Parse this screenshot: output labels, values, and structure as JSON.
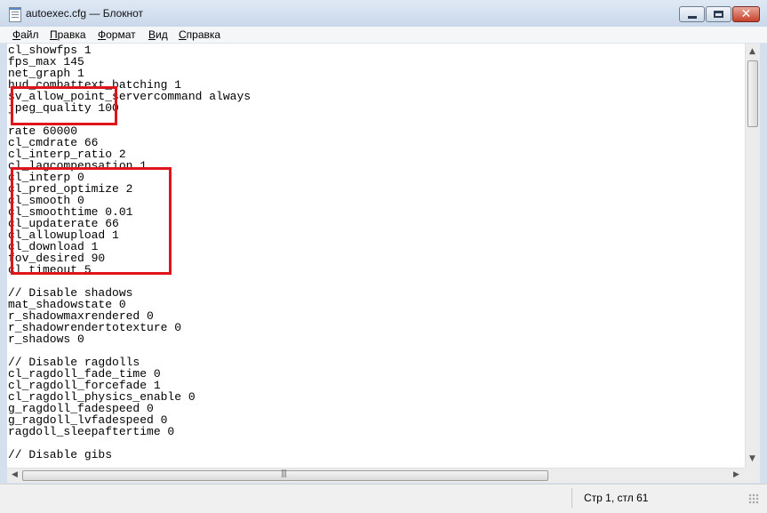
{
  "window": {
    "title": "autoexec.cfg — Блокнот",
    "icon": "notepad-icon"
  },
  "titlebar_buttons": {
    "minimize": "minimize-icon",
    "maximize": "maximize-icon",
    "close": "close-icon",
    "close_glyph": "✕"
  },
  "menu": {
    "file": "Файл",
    "edit": "Правка",
    "format": "Формат",
    "view": "Вид",
    "help": "Справка"
  },
  "editor": {
    "content": "cl_showfps 1\nfps_max 145\nnet_graph 1\nhud_combattext_batching 1\nsv_allow_point_servercommand always\njpeg_quality 100\n\nrate 60000\ncl_cmdrate 66\ncl_interp_ratio 2\ncl_lagcompensation 1\ncl_interp 0\ncl_pred_optimize 2\ncl_smooth 0\ncl_smoothtime 0.01\ncl_updaterate 66\ncl_allowupload 1\ncl_download 1\nfov_desired 90\ncl_timeout 5\n\n// Disable shadows\nmat_shadowstate 0\nr_shadowmaxrendered 0\nr_shadowrendertotexture 0\nr_shadows 0\n\n// Disable ragdolls\ncl_ragdoll_fade_time 0\ncl_ragdoll_forcefade 1\ncl_ragdoll_physics_enable 0\ng_ragdoll_fadespeed 0\ng_ragdoll_lvfadespeed 0\nragdoll_sleepaftertime 0\n\n// Disable gibs"
  },
  "highlight_color": "#e0141b",
  "scrollbars": {
    "up": "▲",
    "down": "▼",
    "left": "◀",
    "right": "▶",
    "grip": "|||"
  },
  "status": {
    "position": "Стр 1, стл 61"
  }
}
